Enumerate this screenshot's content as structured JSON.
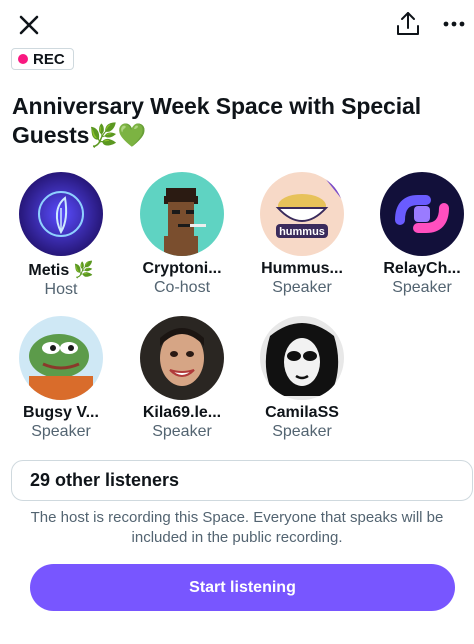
{
  "top_bar": {
    "close_icon": "close-icon",
    "share_icon": "share-icon",
    "more_icon": "more-icon"
  },
  "rec_badge": {
    "label": "REC",
    "dot_color": "#f91880"
  },
  "space": {
    "title": "Anniversary Week Space with Special Guests🌿💚"
  },
  "participants": [
    {
      "name": "Metis 🌿",
      "role": "Host",
      "avatar": "metis-logo-avatar"
    },
    {
      "name": "Cryptoni...",
      "role": "Co-host",
      "avatar": "pixel-punk-avatar"
    },
    {
      "name": "Hummus...",
      "role": "Speaker",
      "avatar": "hummus-bowl-avatar"
    },
    {
      "name": "RelayCh...",
      "role": "Speaker",
      "avatar": "relay-logo-avatar"
    },
    {
      "name": "Bugsy V...",
      "role": "Speaker",
      "avatar": "pepe-frog-avatar"
    },
    {
      "name": "Kila69.le...",
      "role": "Speaker",
      "avatar": "man-photo-avatar"
    },
    {
      "name": "CamilaSS",
      "role": "Speaker",
      "avatar": "woman-sketch-avatar"
    }
  ],
  "listeners": {
    "label": "29 other listeners"
  },
  "recording_note": "The host is recording this Space. Everyone that speaks will be included in the public recording.",
  "start_button": {
    "label": "Start listening",
    "color": "#7856ff"
  }
}
